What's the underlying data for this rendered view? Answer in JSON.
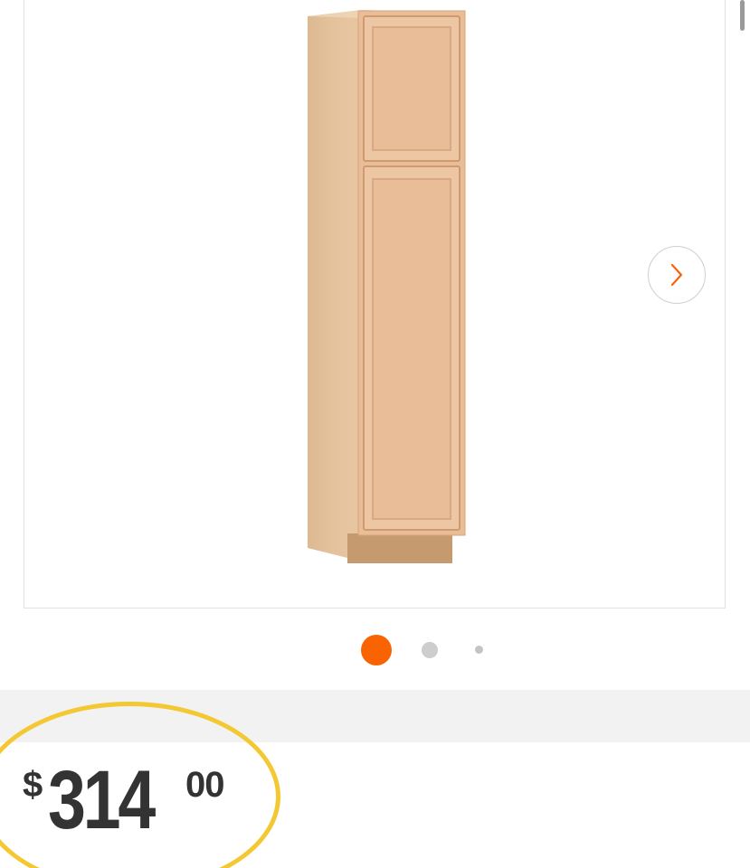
{
  "product": {
    "image_icon": "tall-pantry-cabinet-image",
    "price": {
      "currency": "$",
      "dollars": "314",
      "cents": "00"
    }
  },
  "gallery": {
    "next_icon": "chevron-right-icon",
    "dot_count": 3,
    "active_dot": 1
  },
  "colors": {
    "accent": "#f96302",
    "highlight": "#f3c832",
    "price_text": "#333333",
    "band": "#f2f2f2"
  }
}
